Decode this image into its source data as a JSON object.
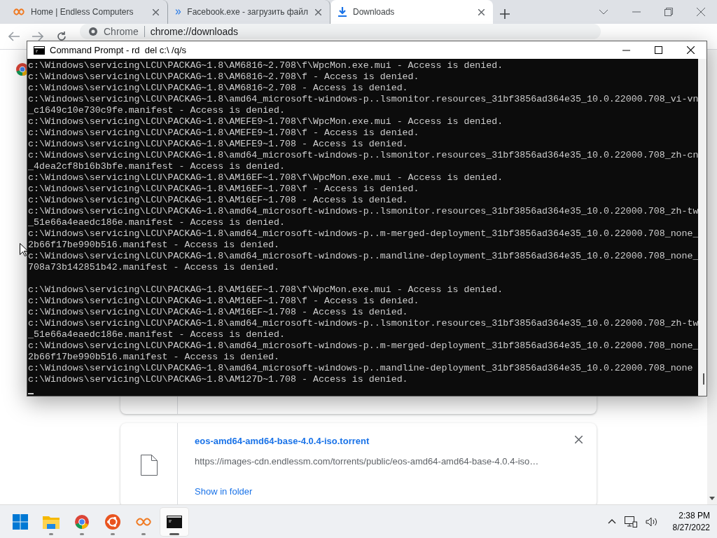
{
  "browser": {
    "tabs": [
      {
        "title": "Home | Endless Computers",
        "kind": "endless",
        "selected": false
      },
      {
        "title": "Facebook.exe - загрузить файл",
        "kind": "chevrons",
        "selected": false
      },
      {
        "title": "Downloads",
        "kind": "download",
        "selected": true
      }
    ],
    "address": {
      "site": "Chrome",
      "url": "chrome://downloads"
    },
    "downloads": [
      {
        "kind": "partial"
      },
      {
        "kind": "item",
        "file": "eos-amd64-amd64-base-4.0.4-iso.torrent",
        "url": "https://images-cdn.endlessm.com/torrents/public/eos-amd64-amd64-base-4.0.4-iso…",
        "action": "Show in folder"
      }
    ]
  },
  "console_window": {
    "title": "Command Prompt - rd  del c:\\ /q/s",
    "cursor": true,
    "blocks": [
      [
        "c:\\Windows\\servicing\\LCU\\PACKAG~1.8\\AM6816~2.708\\f\\WpcMon.exe.mui - Access is denied.",
        "c:\\Windows\\servicing\\LCU\\PACKAG~1.8\\AM6816~2.708\\f - Access is denied.",
        "c:\\Windows\\servicing\\LCU\\PACKAG~1.8\\AM6816~2.708 - Access is denied.",
        "c:\\Windows\\servicing\\LCU\\PACKAG~1.8\\amd64_microsoft-windows-p..lsmonitor.resources_31bf3856ad364e35_10.0.22000.708_vi-vn",
        "_c1649c10e730c9fe.manifest - Access is denied.",
        "c:\\Windows\\servicing\\LCU\\PACKAG~1.8\\AMEFE9~1.708\\f\\WpcMon.exe.mui - Access is denied.",
        "c:\\Windows\\servicing\\LCU\\PACKAG~1.8\\AMEFE9~1.708\\f - Access is denied.",
        "c:\\Windows\\servicing\\LCU\\PACKAG~1.8\\AMEFE9~1.708 - Access is denied.",
        "c:\\Windows\\servicing\\LCU\\PACKAG~1.8\\amd64_microsoft-windows-p..lsmonitor.resources_31bf3856ad364e35_10.0.22000.708_zh-cn",
        "_4dea2cf8b16b3bfe.manifest - Access is denied.",
        "c:\\Windows\\servicing\\LCU\\PACKAG~1.8\\AM16EF~1.708\\f\\WpcMon.exe.mui - Access is denied.",
        "c:\\Windows\\servicing\\LCU\\PACKAG~1.8\\AM16EF~1.708\\f - Access is denied.",
        "c:\\Windows\\servicing\\LCU\\PACKAG~1.8\\AM16EF~1.708 - Access is denied.",
        "c:\\Windows\\servicing\\LCU\\PACKAG~1.8\\amd64_microsoft-windows-p..lsmonitor.resources_31bf3856ad364e35_10.0.22000.708_zh-tw",
        "_51e66a4eaedc186e.manifest - Access is denied.",
        "c:\\Windows\\servicing\\LCU\\PACKAG~1.8\\amd64_microsoft-windows-p..m-merged-deployment_31bf3856ad364e35_10.0.22000.708_none_",
        "2b66f17be990b516.manifest - Access is denied.",
        "c:\\Windows\\servicing\\LCU\\PACKAG~1.8\\amd64_microsoft-windows-p..mandline-deployment_31bf3856ad364e35_10.0.22000.708_none_",
        "708a73b142851b42.manifest - Access is denied."
      ],
      [
        "c:\\Windows\\servicing\\LCU\\PACKAG~1.8\\AM16EF~1.708\\f\\WpcMon.exe.mui - Access is denied.",
        "c:\\Windows\\servicing\\LCU\\PACKAG~1.8\\AM16EF~1.708\\f - Access is denied.",
        "c:\\Windows\\servicing\\LCU\\PACKAG~1.8\\AM16EF~1.708 - Access is denied.",
        "c:\\Windows\\servicing\\LCU\\PACKAG~1.8\\amd64_microsoft-windows-p..lsmonitor.resources_31bf3856ad364e35_10.0.22000.708_zh-tw",
        "_51e66a4eaedc186e.manifest - Access is denied.",
        "c:\\Windows\\servicing\\LCU\\PACKAG~1.8\\amd64_microsoft-windows-p..m-merged-deployment_31bf3856ad364e35_10.0.22000.708_none_",
        "2b66f17be990b516.manifest - Access is denied.",
        "c:\\Windows\\servicing\\LCU\\PACKAG~1.8\\amd64_microsoft-windows-p..mandline-deployment_31bf3856ad364e35_10.0.22000.708_none",
        "c:\\Windows\\servicing\\LCU\\PACKAG~1.8\\AM127D~1.708 - Access is denied."
      ]
    ]
  },
  "taskbar": {
    "apps": [
      {
        "kind": "start",
        "running": false,
        "selected": false
      },
      {
        "kind": "files",
        "running": true,
        "selected": false
      },
      {
        "kind": "chrome",
        "running": true,
        "selected": false
      },
      {
        "kind": "ubuntu",
        "running": true,
        "selected": false
      },
      {
        "kind": "endless",
        "running": true,
        "selected": false
      },
      {
        "kind": "terminal",
        "running": true,
        "selected": true
      }
    ],
    "clock": {
      "time": "2:38 PM",
      "date": "8/27/2022"
    }
  }
}
